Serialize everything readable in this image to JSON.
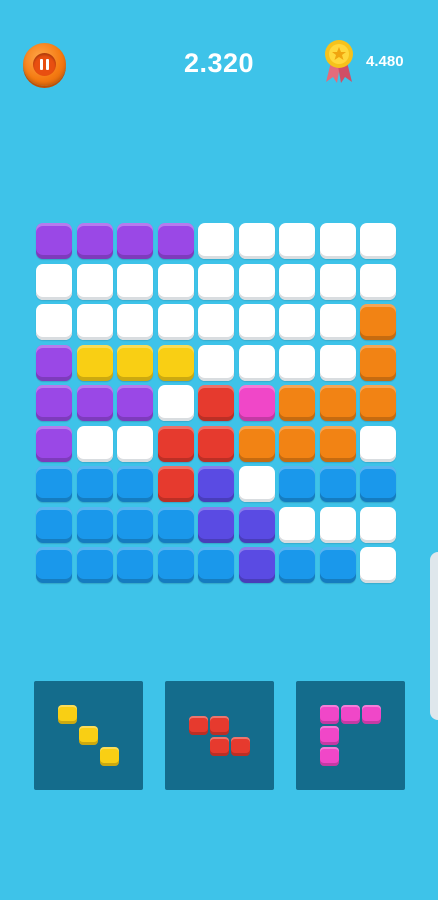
{
  "header": {
    "score": "2.320",
    "best_score": "4.480",
    "icons": {
      "pause": "pause-icon",
      "best": "medal-icon"
    }
  },
  "colors": {
    "background": "#3ec3e9",
    "empty": "#ffffff",
    "purple": "#9a48e6",
    "yellow": "#f9cf14",
    "red": "#e63a2e",
    "magenta": "#f047c8",
    "orange": "#f28314",
    "blue": "#1a98eb",
    "indigo": "#5a4be3",
    "tray": "#146c8c"
  },
  "board": {
    "rows": 9,
    "cols": 9,
    "grid": [
      [
        "purple",
        "purple",
        "purple",
        "purple",
        "empty",
        "empty",
        "empty",
        "empty",
        "empty"
      ],
      [
        "empty",
        "empty",
        "empty",
        "empty",
        "empty",
        "empty",
        "empty",
        "empty",
        "empty"
      ],
      [
        "empty",
        "empty",
        "empty",
        "empty",
        "empty",
        "empty",
        "empty",
        "empty",
        "orange"
      ],
      [
        "purple",
        "yellow",
        "yellow",
        "yellow",
        "empty",
        "empty",
        "empty",
        "empty",
        "orange"
      ],
      [
        "purple",
        "purple",
        "purple",
        "empty",
        "red",
        "magenta",
        "orange",
        "orange",
        "orange"
      ],
      [
        "purple",
        "empty",
        "empty",
        "red",
        "red",
        "orange",
        "orange",
        "orange",
        "empty"
      ],
      [
        "blue",
        "blue",
        "blue",
        "red",
        "indigo",
        "empty",
        "blue",
        "blue",
        "blue"
      ],
      [
        "blue",
        "blue",
        "blue",
        "blue",
        "indigo",
        "indigo",
        "empty",
        "empty",
        "empty"
      ],
      [
        "blue",
        "blue",
        "blue",
        "blue",
        "blue",
        "indigo",
        "blue",
        "blue",
        "empty"
      ]
    ]
  },
  "pieces": [
    {
      "name": "yellow-diagonal-piece",
      "color": "yellow",
      "cells": [
        [
          0,
          0
        ],
        [
          1,
          1
        ],
        [
          2,
          2
        ]
      ]
    },
    {
      "name": "red-z-piece",
      "color": "red",
      "cells": [
        [
          0,
          0
        ],
        [
          0,
          1
        ],
        [
          1,
          1
        ],
        [
          1,
          2
        ]
      ]
    },
    {
      "name": "magenta-corner-piece",
      "color": "magenta",
      "cells": [
        [
          0,
          0
        ],
        [
          0,
          1
        ],
        [
          0,
          2
        ],
        [
          1,
          0
        ],
        [
          2,
          0
        ]
      ]
    }
  ]
}
